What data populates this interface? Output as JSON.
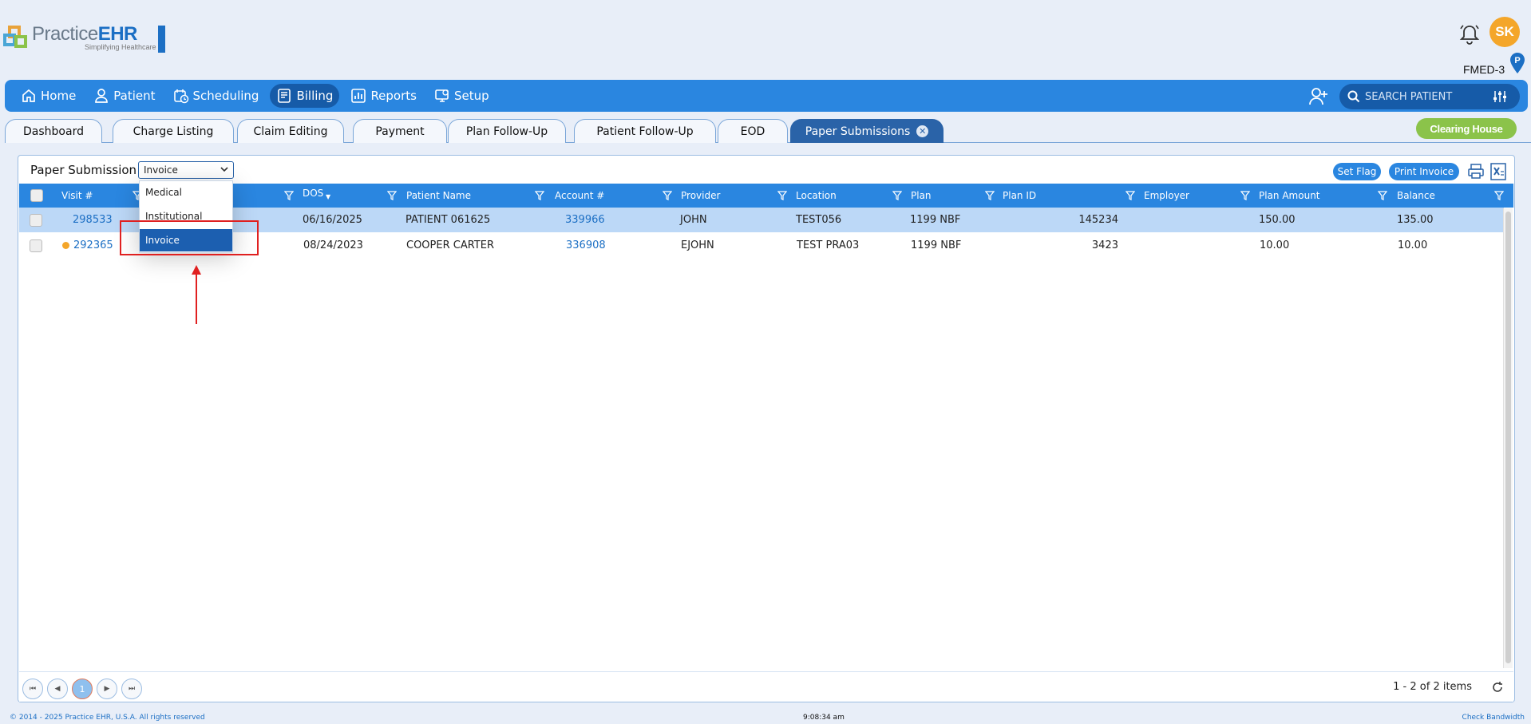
{
  "brand": {
    "name_light": "Practice",
    "name_bold": "EHR",
    "tagline": "Simplifying Healthcare"
  },
  "user": {
    "initials": "SK",
    "facility": "FMED-3",
    "pin_letter": "P"
  },
  "nav": {
    "items": [
      "Home",
      "Patient",
      "Scheduling",
      "Billing",
      "Reports",
      "Setup"
    ],
    "active": "Billing",
    "search_placeholder": "SEARCH PATIENT"
  },
  "tabs": [
    "Dashboard",
    "Charge Listing",
    "Claim Editing",
    "Payment",
    "Plan Follow-Up",
    "Patient Follow-Up",
    "EOD",
    "Paper Submissions"
  ],
  "active_tab": "Paper Submissions",
  "clearing_house": "Clearing House",
  "panel": {
    "title": "Paper Submission",
    "select_value": "Invoice",
    "set_flag": "Set Flag",
    "print_invoice": "Print Invoice"
  },
  "dropdown_options": [
    "Medical",
    "Institutional",
    "Invoice"
  ],
  "grid": {
    "columns": [
      "Visit #",
      "DOS",
      "Patient Name",
      "Account #",
      "Provider",
      "Location",
      "Plan",
      "Plan ID",
      "Employer",
      "Plan Amount",
      "Balance"
    ],
    "rows": [
      {
        "visit": "298533",
        "dos": "06/16/2025",
        "patient": "PATIENT 061625",
        "account": "339966",
        "provider": "JOHN",
        "location": "TEST056",
        "plan": "1199 NBF",
        "plan_id": "145234",
        "employer": "",
        "plan_amount": "150.00",
        "balance": "135.00"
      },
      {
        "visit": "292365",
        "dos": "08/24/2023",
        "patient": "COOPER CARTER",
        "account": "336908",
        "provider": "EJOHN",
        "location": "TEST PRA03",
        "plan": "1199 NBF",
        "plan_id": "3423",
        "employer": "",
        "plan_amount": "10.00",
        "balance": "10.00"
      }
    ]
  },
  "pager": {
    "current_page": "1",
    "info": "1 - 2 of 2 items"
  },
  "footer": {
    "copyright": "© 2014 - 2025 Practice EHR, U.S.A. All rights reserved",
    "time": "9:08:34 am",
    "bandwidth": "Check Bandwidth"
  },
  "colors": {
    "primary": "#2a86e0",
    "dark": "#165ba8",
    "accent": "#f4a62a",
    "green": "#8bc34a",
    "annotation": "#e02020"
  }
}
